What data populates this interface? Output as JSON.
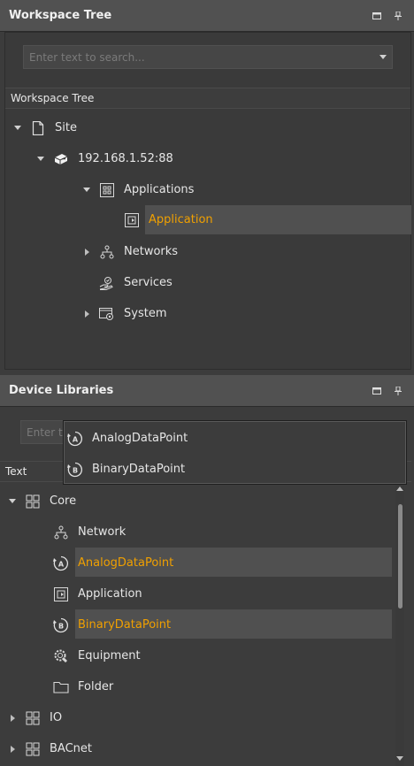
{
  "workspace_tree": {
    "title": "Workspace Tree",
    "search_placeholder": "Enter text to search...",
    "column_header": "Workspace Tree",
    "nodes": [
      {
        "label": "Site",
        "icon": "document-icon",
        "expanded": true
      },
      {
        "label": "192.168.1.52:88",
        "icon": "server-icon",
        "expanded": true
      },
      {
        "label": "Applications",
        "icon": "applications-grid-icon",
        "expanded": true
      },
      {
        "label": "Application",
        "icon": "application-icon",
        "selected": true
      },
      {
        "label": "Networks",
        "icon": "network-icon",
        "expanded": false
      },
      {
        "label": "Services",
        "icon": "services-hand-icon"
      },
      {
        "label": "System",
        "icon": "system-gear-icon",
        "expanded": false
      }
    ]
  },
  "device_libraries": {
    "title": "Device Libraries",
    "search_placeholder": "Enter t",
    "column_header": "Text",
    "nodes": [
      {
        "label": "Core",
        "icon": "grid-icon",
        "expanded": true
      },
      {
        "label": "Network",
        "icon": "network-icon"
      },
      {
        "label": "AnalogDataPoint",
        "icon": "analog-datapoint-icon",
        "highlighted": true
      },
      {
        "label": "Application",
        "icon": "application-icon"
      },
      {
        "label": "BinaryDataPoint",
        "icon": "binary-datapoint-icon",
        "highlighted": true
      },
      {
        "label": "Equipment",
        "icon": "equipment-gear-icon"
      },
      {
        "label": "Folder",
        "icon": "folder-icon"
      },
      {
        "label": "IO",
        "icon": "grid-icon",
        "expanded": false
      },
      {
        "label": "BACnet",
        "icon": "grid-icon",
        "expanded": false
      }
    ]
  },
  "drag_popup": {
    "items": [
      {
        "label": "AnalogDataPoint",
        "icon": "analog-datapoint-icon"
      },
      {
        "label": "BinaryDataPoint",
        "icon": "binary-datapoint-icon"
      }
    ]
  },
  "colors": {
    "accent": "#f0a000",
    "header_bg": "#515151",
    "panel_bg": "#3c3c3c",
    "selection_bg": "#505050"
  }
}
